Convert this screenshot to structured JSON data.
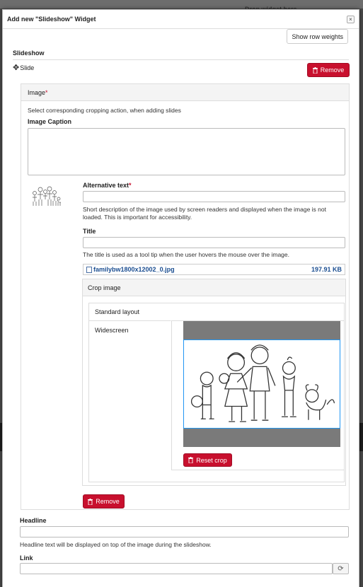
{
  "background": {
    "drop_hint": "Drop widget here",
    "side_marker": "%"
  },
  "dialog": {
    "title": "Add new \"Slideshow\" Widget",
    "close_label": "×",
    "row_weights_label": "Show row weights"
  },
  "section": {
    "title": "Slideshow",
    "slide_label": "Slide",
    "remove_label": "Remove"
  },
  "image_panel": {
    "header": "Image",
    "required_mark": "*",
    "cropping_help": "Select corresponding cropping action, when adding slides",
    "caption_label": "Image Caption",
    "caption_value": "",
    "alt_label": "Alternative text",
    "alt_required_mark": "*",
    "alt_value": "",
    "alt_help": "Short description of the image used by screen readers and displayed when the image is not loaded. This is important for accessibility.",
    "title_label": "Title",
    "title_value": "",
    "title_help": "The title is used as a tool tip when the user hovers the mouse over the image.",
    "file_name": "familybw1800x12002_0.jpg",
    "file_size": "197.91 KB",
    "crop_header": "Crop image",
    "crop_tabs": [
      "Standard layout",
      "Widescreen"
    ],
    "reset_crop_label": "Reset crop",
    "remove_label": "Remove"
  },
  "headline": {
    "label": "Headline",
    "value": "",
    "help": "Headline text will be displayed on top of the image during the slideshow."
  },
  "link": {
    "label": "Link",
    "value": "",
    "refresh_icon": "refresh-icon"
  },
  "colors": {
    "danger": "#c8102e",
    "link": "#1b4e91",
    "crop_border": "#2196f3"
  }
}
